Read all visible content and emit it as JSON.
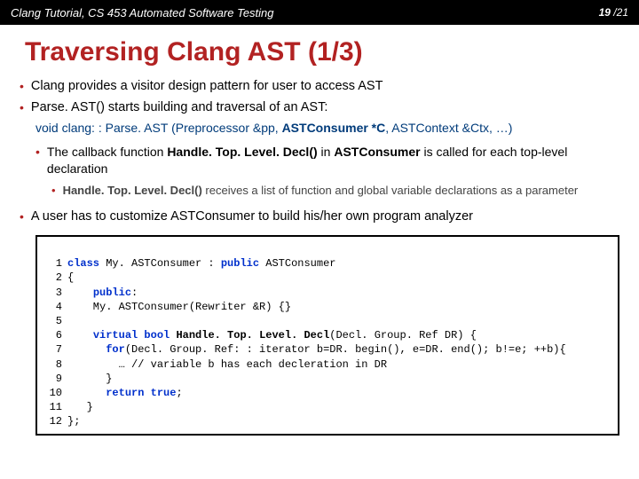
{
  "header": {
    "left": "Clang Tutorial, CS 453 Automated Software Testing",
    "page_current": "19",
    "page_sep": " /",
    "page_total": "21"
  },
  "title": "Traversing Clang AST (1/3)",
  "b1a": "Clang provides a visitor design pattern for user to access AST",
  "b1b_pre": "Parse. AST()",
  "b1b_post": " starts building and traversal of an AST:",
  "sig": {
    "kw": "void ",
    "fn": "clang: : Parse. AST ",
    "args_open": "(Preprocessor &pp, ",
    "arg_bold": "ASTConsumer *C",
    "args_close": ", ASTContext &Ctx, …)"
  },
  "b2a_pre": "The callback function ",
  "b2a_bold1": "Handle. Top. Level. Decl() ",
  "b2a_mid": "in ",
  "b2a_bold2": "ASTConsumer ",
  "b2a_post": "is called for each top-level declaration",
  "b3a_bold": "Handle. Top. Level. Decl()",
  "b3a_post": " receives a list of function and global variable declarations as a parameter",
  "b1c": "A user has to customize ASTConsumer to build his/her own program analyzer",
  "code": {
    "l1_kw": "class",
    "l1_name": " My. ASTConsumer : ",
    "l1_kw2": "public",
    "l1_rest": " ASTConsumer",
    "l2": "{",
    "l3_kw": "public",
    "l3_rest": ":",
    "l4": "    My. ASTConsumer(Rewriter &R) {}",
    "l5": "",
    "l6_kw1": "virtual",
    "l6_kw2": " bool",
    "l6_fn": " Handle. Top. Level. Decl",
    "l6_rest": "(Decl. Group. Ref DR) {",
    "l7_kw": "for",
    "l7_rest": "(Decl. Group. Ref: : iterator b=DR. begin(), e=DR. end(); b!=e; ++b){",
    "l8": "        … // variable b has each decleration in DR",
    "l9": "      }",
    "l10_kw": "return",
    "l10_kw2": " true",
    "l10_rest": ";",
    "l11": "   }",
    "l12": "};",
    "ln1": "1",
    "ln2": "2",
    "ln3": "3",
    "ln4": "4",
    "ln5": "5",
    "ln6": "6",
    "ln7": "7",
    "ln8": "8",
    "ln9": "9",
    "ln10": "10",
    "ln11": "11",
    "ln12": "12"
  }
}
